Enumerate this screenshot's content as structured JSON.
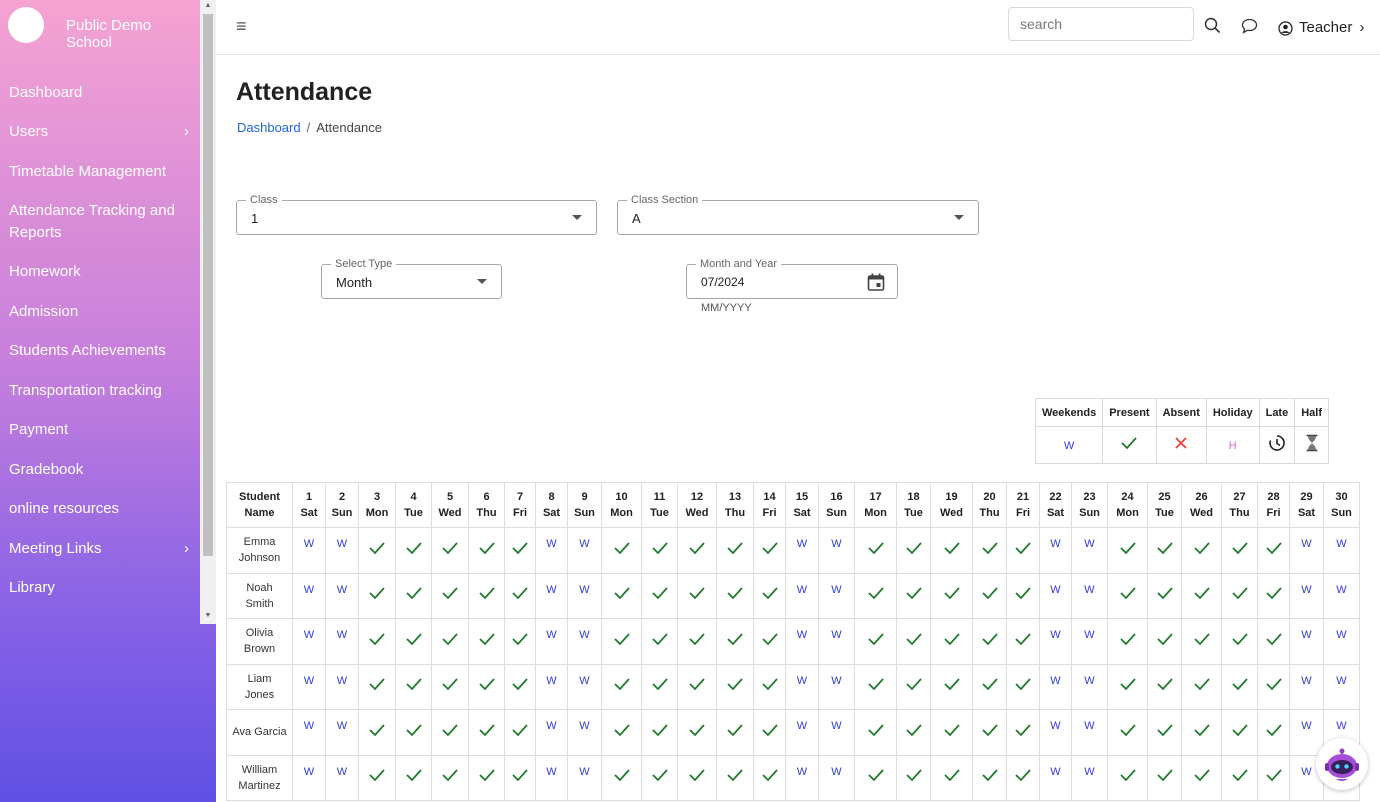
{
  "sidebar": {
    "school_name": "Public Demo School",
    "items": [
      {
        "label": "Dashboard",
        "has_children": false
      },
      {
        "label": "Users",
        "has_children": true
      },
      {
        "label": "Timetable Management",
        "has_children": false
      },
      {
        "label": "Attendance Tracking and Reports",
        "has_children": false
      },
      {
        "label": "Homework",
        "has_children": false
      },
      {
        "label": "Admission",
        "has_children": false
      },
      {
        "label": "Students Achievements",
        "has_children": false
      },
      {
        "label": "Transportation tracking",
        "has_children": false
      },
      {
        "label": "Payment",
        "has_children": false
      },
      {
        "label": "Gradebook",
        "has_children": false
      },
      {
        "label": "online resources",
        "has_children": false
      },
      {
        "label": "Meeting Links",
        "has_children": true
      },
      {
        "label": "Library",
        "has_children": false
      }
    ],
    "gradient": [
      "#f5a3d2",
      "#c77fdc",
      "#8a63e6",
      "#6050e4"
    ]
  },
  "topbar": {
    "search_placeholder": "search",
    "user_label": "Teacher",
    "icons": [
      "menu-icon",
      "search-icon",
      "chat-icon",
      "user-circle-icon",
      "chevron-right-icon"
    ]
  },
  "page": {
    "title": "Attendance",
    "breadcrumb": [
      "Dashboard",
      "Attendance"
    ]
  },
  "filters": {
    "class": {
      "label": "Class",
      "value": "1"
    },
    "section": {
      "label": "Class Section",
      "value": "A"
    },
    "type": {
      "label": "Select Type",
      "value": "Month"
    },
    "month": {
      "label": "Month and Year",
      "value": "07/2024",
      "helper": "MM/YYYY"
    }
  },
  "legend": {
    "headers": [
      "Weekends",
      "Present",
      "Absent",
      "Holiday",
      "Late",
      "Half"
    ],
    "weekend_symbol": "W",
    "holiday_symbol": "H",
    "colors": {
      "weekend": "#2f3cd6",
      "present": "#1f7a2e",
      "absent": "#e0443a",
      "holiday": "#d36ad6"
    }
  },
  "attendance": {
    "name_header": [
      "Student",
      "Name"
    ],
    "days": [
      {
        "d": "1",
        "w": "Sat"
      },
      {
        "d": "2",
        "w": "Sun"
      },
      {
        "d": "3",
        "w": "Mon"
      },
      {
        "d": "4",
        "w": "Tue"
      },
      {
        "d": "5",
        "w": "Wed"
      },
      {
        "d": "6",
        "w": "Thu"
      },
      {
        "d": "7",
        "w": "Fri"
      },
      {
        "d": "8",
        "w": "Sat"
      },
      {
        "d": "9",
        "w": "Sun"
      },
      {
        "d": "10",
        "w": "Mon"
      },
      {
        "d": "11",
        "w": "Tue"
      },
      {
        "d": "12",
        "w": "Wed"
      },
      {
        "d": "13",
        "w": "Thu"
      },
      {
        "d": "14",
        "w": "Fri"
      },
      {
        "d": "15",
        "w": "Sat"
      },
      {
        "d": "16",
        "w": "Sun"
      },
      {
        "d": "17",
        "w": "Mon"
      },
      {
        "d": "18",
        "w": "Tue"
      },
      {
        "d": "19",
        "w": "Wed"
      },
      {
        "d": "20",
        "w": "Thu"
      },
      {
        "d": "21",
        "w": "Fri"
      },
      {
        "d": "22",
        "w": "Sat"
      },
      {
        "d": "23",
        "w": "Sun"
      },
      {
        "d": "24",
        "w": "Mon"
      },
      {
        "d": "25",
        "w": "Tue"
      },
      {
        "d": "26",
        "w": "Wed"
      },
      {
        "d": "27",
        "w": "Thu"
      },
      {
        "d": "28",
        "w": "Fri"
      },
      {
        "d": "29",
        "w": "Sat"
      },
      {
        "d": "30",
        "w": "Sun"
      }
    ],
    "students": [
      {
        "name": [
          "Emma",
          "Johnson"
        ],
        "status": "WWPPPPPWWPPPPPWWPPPPPWWPPPPPWW"
      },
      {
        "name": [
          "Noah",
          "Smith"
        ],
        "status": "WWPPPPPWWPPPPPWWPPPPPWWPPPPPWW"
      },
      {
        "name": [
          "Olivia",
          "Brown"
        ],
        "status": "WWPPPPPWWPPPPPWWPPPPPWWPPPPPWW"
      },
      {
        "name": [
          "Liam",
          "Jones"
        ],
        "status": "WWPPPPPWWPPPPPWWPPPPPWWPPPPPWW"
      },
      {
        "name": [
          "Ava Garcia"
        ],
        "status": "WWPPPPPWWPPPPPWWPPPPPWWPPPPPWW"
      },
      {
        "name": [
          "William",
          "Martinez"
        ],
        "status": "WWPPPPPWWPPPPPWWPPPPPWWPPPPPWW"
      }
    ]
  }
}
